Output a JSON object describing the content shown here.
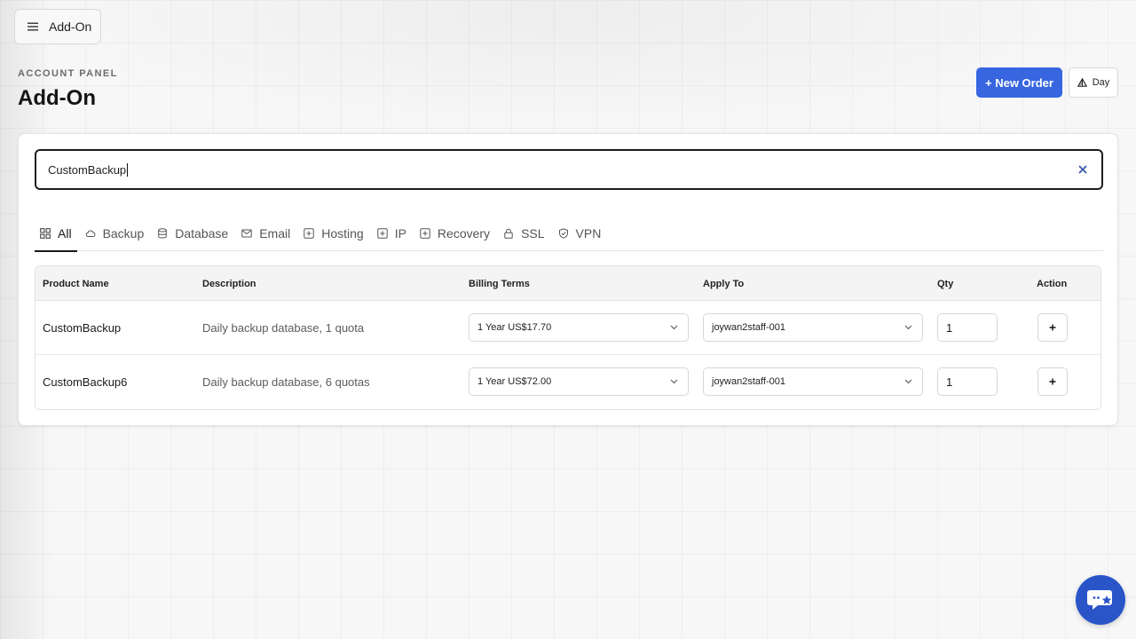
{
  "header": {
    "menu_label": "Add-On",
    "eyebrow": "ACCOUNT PANEL",
    "title": "Add-On",
    "new_order_label": "+ New Order",
    "day_label": "Day"
  },
  "search": {
    "value": "CustomBackup"
  },
  "tabs": [
    {
      "label": "All",
      "icon": "grid-icon",
      "active": true
    },
    {
      "label": "Backup",
      "icon": "cloud-icon"
    },
    {
      "label": "Database",
      "icon": "database-icon"
    },
    {
      "label": "Email",
      "icon": "mail-icon"
    },
    {
      "label": "Hosting",
      "icon": "plus-square-icon"
    },
    {
      "label": "IP",
      "icon": "plus-square-icon"
    },
    {
      "label": "Recovery",
      "icon": "plus-square-icon"
    },
    {
      "label": "SSL",
      "icon": "lock-icon"
    },
    {
      "label": "VPN",
      "icon": "shield-icon"
    }
  ],
  "table": {
    "columns": [
      "Product Name",
      "Description",
      "Billing Terms",
      "Apply To",
      "Qty",
      "Action"
    ],
    "rows": [
      {
        "name": "CustomBackup",
        "description": "Daily backup database, 1 quota",
        "billing": "1 Year US$17.70",
        "apply_to": "joywan2staff-001",
        "qty": "1"
      },
      {
        "name": "CustomBackup6",
        "description": "Daily backup database, 6 quotas",
        "billing": "1 Year US$72.00",
        "apply_to": "joywan2staff-001",
        "qty": "1"
      }
    ]
  },
  "colors": {
    "accent": "#3766e0",
    "chat": "#2a55c9"
  },
  "icons": {
    "menu": "menu-icon",
    "day": "theme-icon",
    "clear": "close-icon",
    "chat": "chat-icon"
  }
}
